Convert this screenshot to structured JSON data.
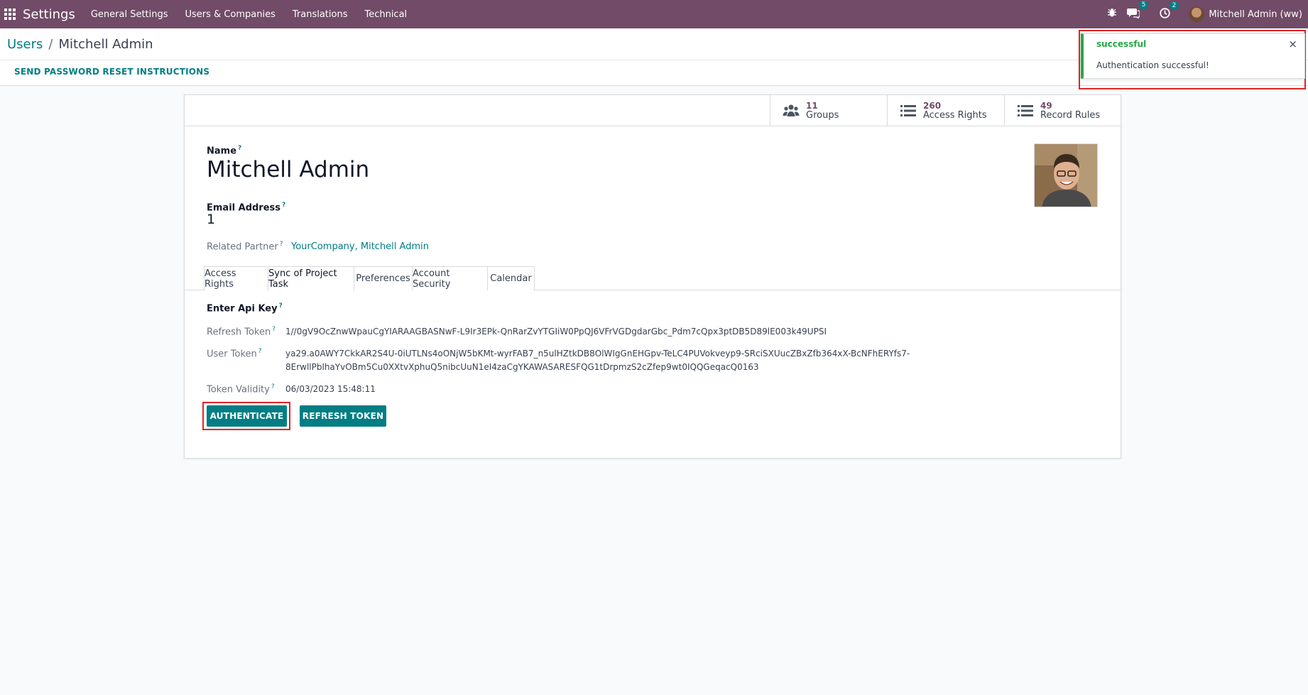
{
  "navbar": {
    "app_name": "Settings",
    "menus": [
      "General Settings",
      "Users & Companies",
      "Translations",
      "Technical"
    ],
    "messages_count": "5",
    "activities_count": "2",
    "user_name": "Mitchell Admin (ww)",
    "bg_color": "#714b67"
  },
  "breadcrumb": {
    "parent": "Users",
    "separator": "/",
    "current": "Mitchell Admin"
  },
  "actions": {
    "send_reset": "SEND PASSWORD RESET INSTRUCTIONS"
  },
  "stat_buttons": [
    {
      "value": "11",
      "label": "Groups",
      "icon": "groups-icon"
    },
    {
      "value": "260",
      "label": "Access Rights",
      "icon": "list-icon"
    },
    {
      "value": "49",
      "label": "Record Rules",
      "icon": "list-icon"
    }
  ],
  "form": {
    "name_label": "Name",
    "name_value": "Mitchell Admin",
    "email_label": "Email Address",
    "email_value": "1",
    "partner_label": "Related Partner",
    "partner_value": "YourCompany, Mitchell Admin",
    "help_mark": "?"
  },
  "tabs": [
    "Access Rights",
    "Sync of Project Task",
    "Preferences",
    "Account Security",
    "Calendar"
  ],
  "active_tab": "Sync of Project Task",
  "sync": {
    "section_title": "Enter Api Key",
    "refresh_token_label": "Refresh Token",
    "refresh_token_value": "1//0gV9OcZnwWpauCgYIARAAGBASNwF-L9Ir3EPk-QnRarZvYTGIiW0PpQJ6VFrVGDgdarGbc_Pdm7cQpx3ptDB5D89lE003k49UPSI",
    "user_token_label": "User Token",
    "user_token_line1": "ya29.a0AWY7CkkAR2S4U-0iUTLNs4oONjW5bKMt-wyrFAB7_n5ulHZtkDB8OlWIgGnEHGpv-TeLC4PUVokveyp9-SRciSXUucZBxZfb364xX-BcNFhERYfs7-",
    "user_token_line2": "8ErwllPblhaYvOBm5Cu0XXtvXphuQ5nibcUuN1eI4zaCgYKAWASARESFQG1tDrpmzS2cZfep9wt0IQQGeqacQ0163",
    "token_validity_label": "Token Validity",
    "token_validity_value": "06/03/2023 15:48:11",
    "authenticate_button": "AUTHENTICATE",
    "refresh_button": "REFRESH TOKEN"
  },
  "notification": {
    "title": "successful",
    "message": "Authentication successful!",
    "close": "×",
    "accent": "#28a745"
  },
  "colors": {
    "primary": "#017e84",
    "highlight": "#dc2626"
  }
}
